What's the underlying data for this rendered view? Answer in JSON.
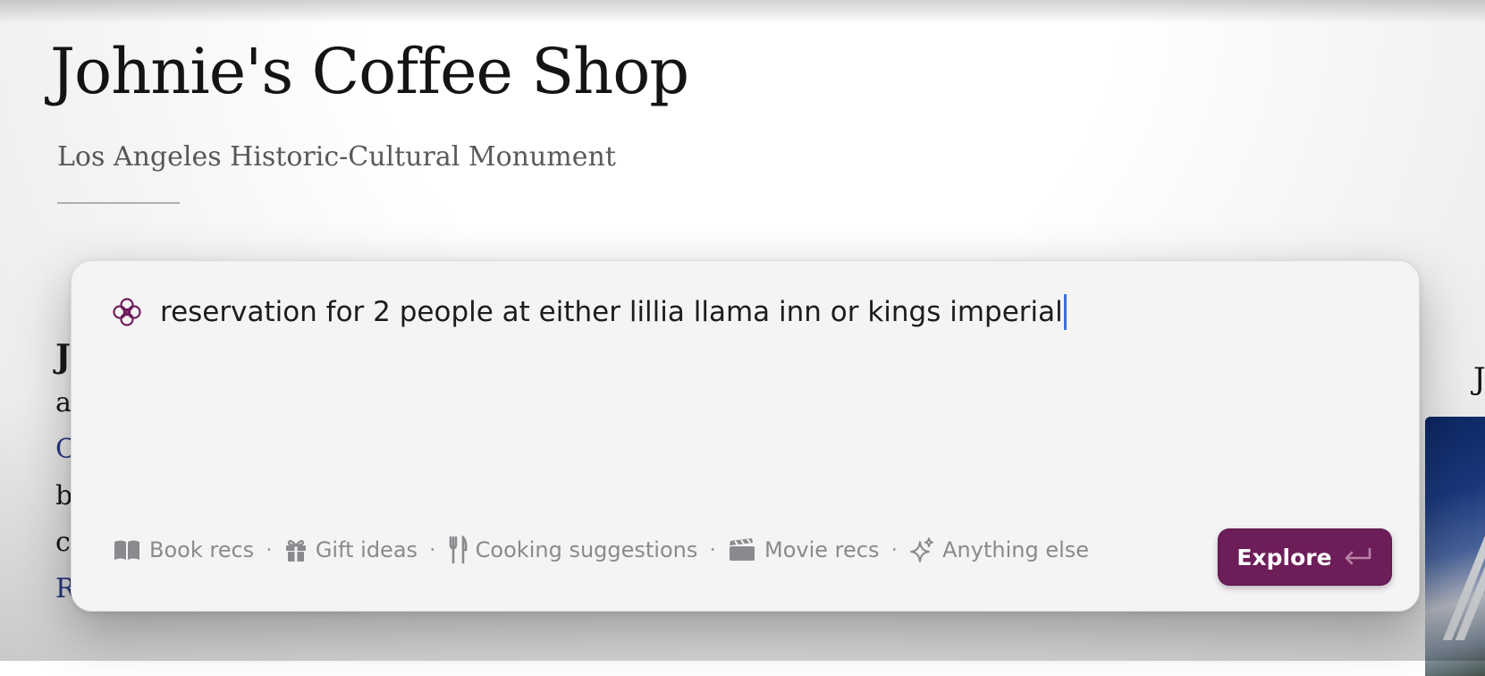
{
  "article": {
    "title": "Johnie's Coffee Shop",
    "subtitle": "Los Angeles Historic-Cultural Monument",
    "fragments": [
      "J",
      "a",
      "C",
      "b",
      "c",
      "R"
    ],
    "right_fragment": "J"
  },
  "palette": {
    "icon": "flower-icon",
    "query": "reservation for 2 people at either lillia llama inn or kings imperial",
    "suggestions": [
      {
        "icon": "book-icon",
        "label": "Book recs"
      },
      {
        "icon": "gift-icon",
        "label": "Gift ideas"
      },
      {
        "icon": "utensils-icon",
        "label": "Cooking suggestions"
      },
      {
        "icon": "clapperboard-icon",
        "label": "Movie recs"
      },
      {
        "icon": "sparkle-icon",
        "label": "Anything else"
      }
    ],
    "separator": "·",
    "explore_label": "Explore",
    "explore_icon": "return-icon"
  },
  "colors": {
    "accent": "#6d1e59",
    "caret": "#3a6fd8",
    "link": "#2c3d8f",
    "suggestion_text": "#8a8a8e"
  }
}
